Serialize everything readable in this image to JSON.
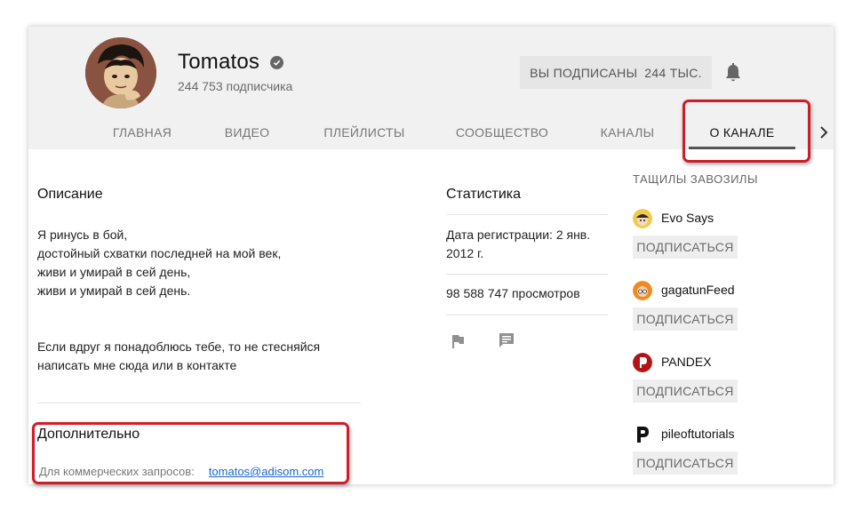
{
  "channel": {
    "name": "Tomatos",
    "subscribers_text": "244 753 подписчика",
    "subscribe_state_label": "ВЫ ПОДПИСАНЫ",
    "subscribe_count": "244 ТЫС."
  },
  "tabs": [
    {
      "label": "ГЛАВНАЯ"
    },
    {
      "label": "ВИДЕО"
    },
    {
      "label": "ПЛЕЙЛИСТЫ"
    },
    {
      "label": "СООБЩЕСТВО"
    },
    {
      "label": "КАНАЛЫ"
    },
    {
      "label": "О КАНАЛЕ"
    }
  ],
  "about": {
    "description_title": "Описание",
    "description_lines": [
      "Я ринусь в бой,",
      "достойный схватки последней на мой век,",
      "живи и умирай в сей день,",
      "живи и умирай в сей день.",
      "Если вдруг я понадоблюсь тебе, то не стесняйся",
      "написать мне сюда или в контакте"
    ],
    "additional_title": "Дополнительно",
    "business_label": "Для коммерческих запросов:",
    "business_email": "tomatos@adisom.com"
  },
  "stats": {
    "title": "Статистика",
    "joined_line1": "Дата регистрации: 2 янв.",
    "joined_line2": "2012 г.",
    "views": "98 588 747 просмотров"
  },
  "featured": {
    "title": "ТАЩИЛЫ ЗАВОЗИЛЫ",
    "channels": [
      {
        "name": "Evo Says",
        "button": "ПОДПИСАТЬСЯ"
      },
      {
        "name": "gagatunFeed",
        "button": "ПОДПИСАТЬСЯ"
      },
      {
        "name": "PANDEX",
        "button": "ПОДПИСАТЬСЯ"
      },
      {
        "name": "pileoftutorials",
        "button": "ПОДПИСАТЬСЯ"
      }
    ]
  },
  "colors": {
    "highlight": "#d01c27",
    "link": "#1a67c9",
    "header_bg": "#f1f1f1"
  }
}
